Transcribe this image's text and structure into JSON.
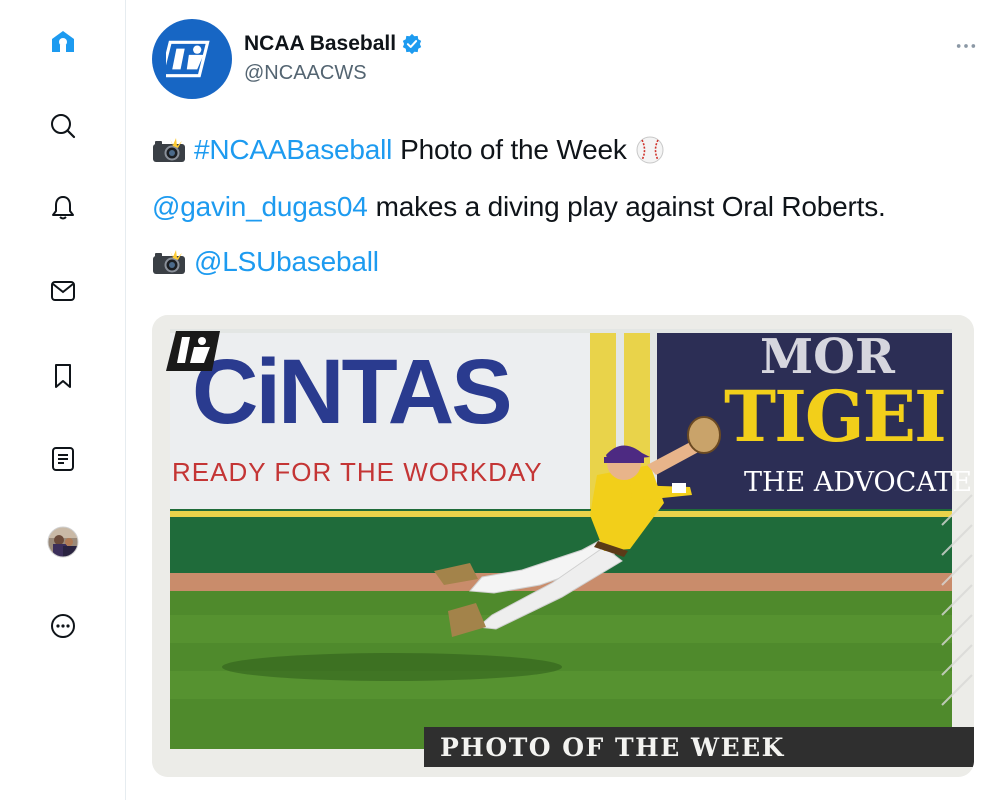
{
  "sidebar": {
    "items": [
      {
        "name": "home",
        "icon": "home-icon",
        "active": true
      },
      {
        "name": "explore",
        "icon": "search-icon"
      },
      {
        "name": "notifications",
        "icon": "bell-icon"
      },
      {
        "name": "messages",
        "icon": "mail-icon"
      },
      {
        "name": "bookmarks",
        "icon": "bookmark-icon"
      },
      {
        "name": "lists",
        "icon": "list-icon"
      },
      {
        "name": "profile",
        "icon": "avatar"
      },
      {
        "name": "more",
        "icon": "more-circle-icon"
      }
    ]
  },
  "tweet": {
    "author": {
      "name": "NCAA Baseball",
      "handle": "@NCAACWS",
      "verified": true
    },
    "lines": {
      "hashtag": "#NCAABaseball",
      "line1_text": "Photo of the Week",
      "mention1": "@gavin_dugas04",
      "line2_text": "makes a diving play against Oral Roberts.",
      "mention2": "@LSUbaseball"
    },
    "media": {
      "banner_left_brand": "CiNTAS",
      "banner_left_tagline": "READY FOR THE WORKDAY",
      "banner_right_top": "MOR",
      "banner_right_main": "TIGEI",
      "banner_right_sub": "THE ADVOCATE",
      "overlay_text": "PHOTO OF THE WEEK"
    }
  },
  "colors": {
    "accent": "#1d9bf0",
    "ncaa_blue": "#1766c4",
    "grass": "#4f8a2c",
    "lsu_gold": "#f2cf1a",
    "lsu_purple": "#4d2a82"
  }
}
